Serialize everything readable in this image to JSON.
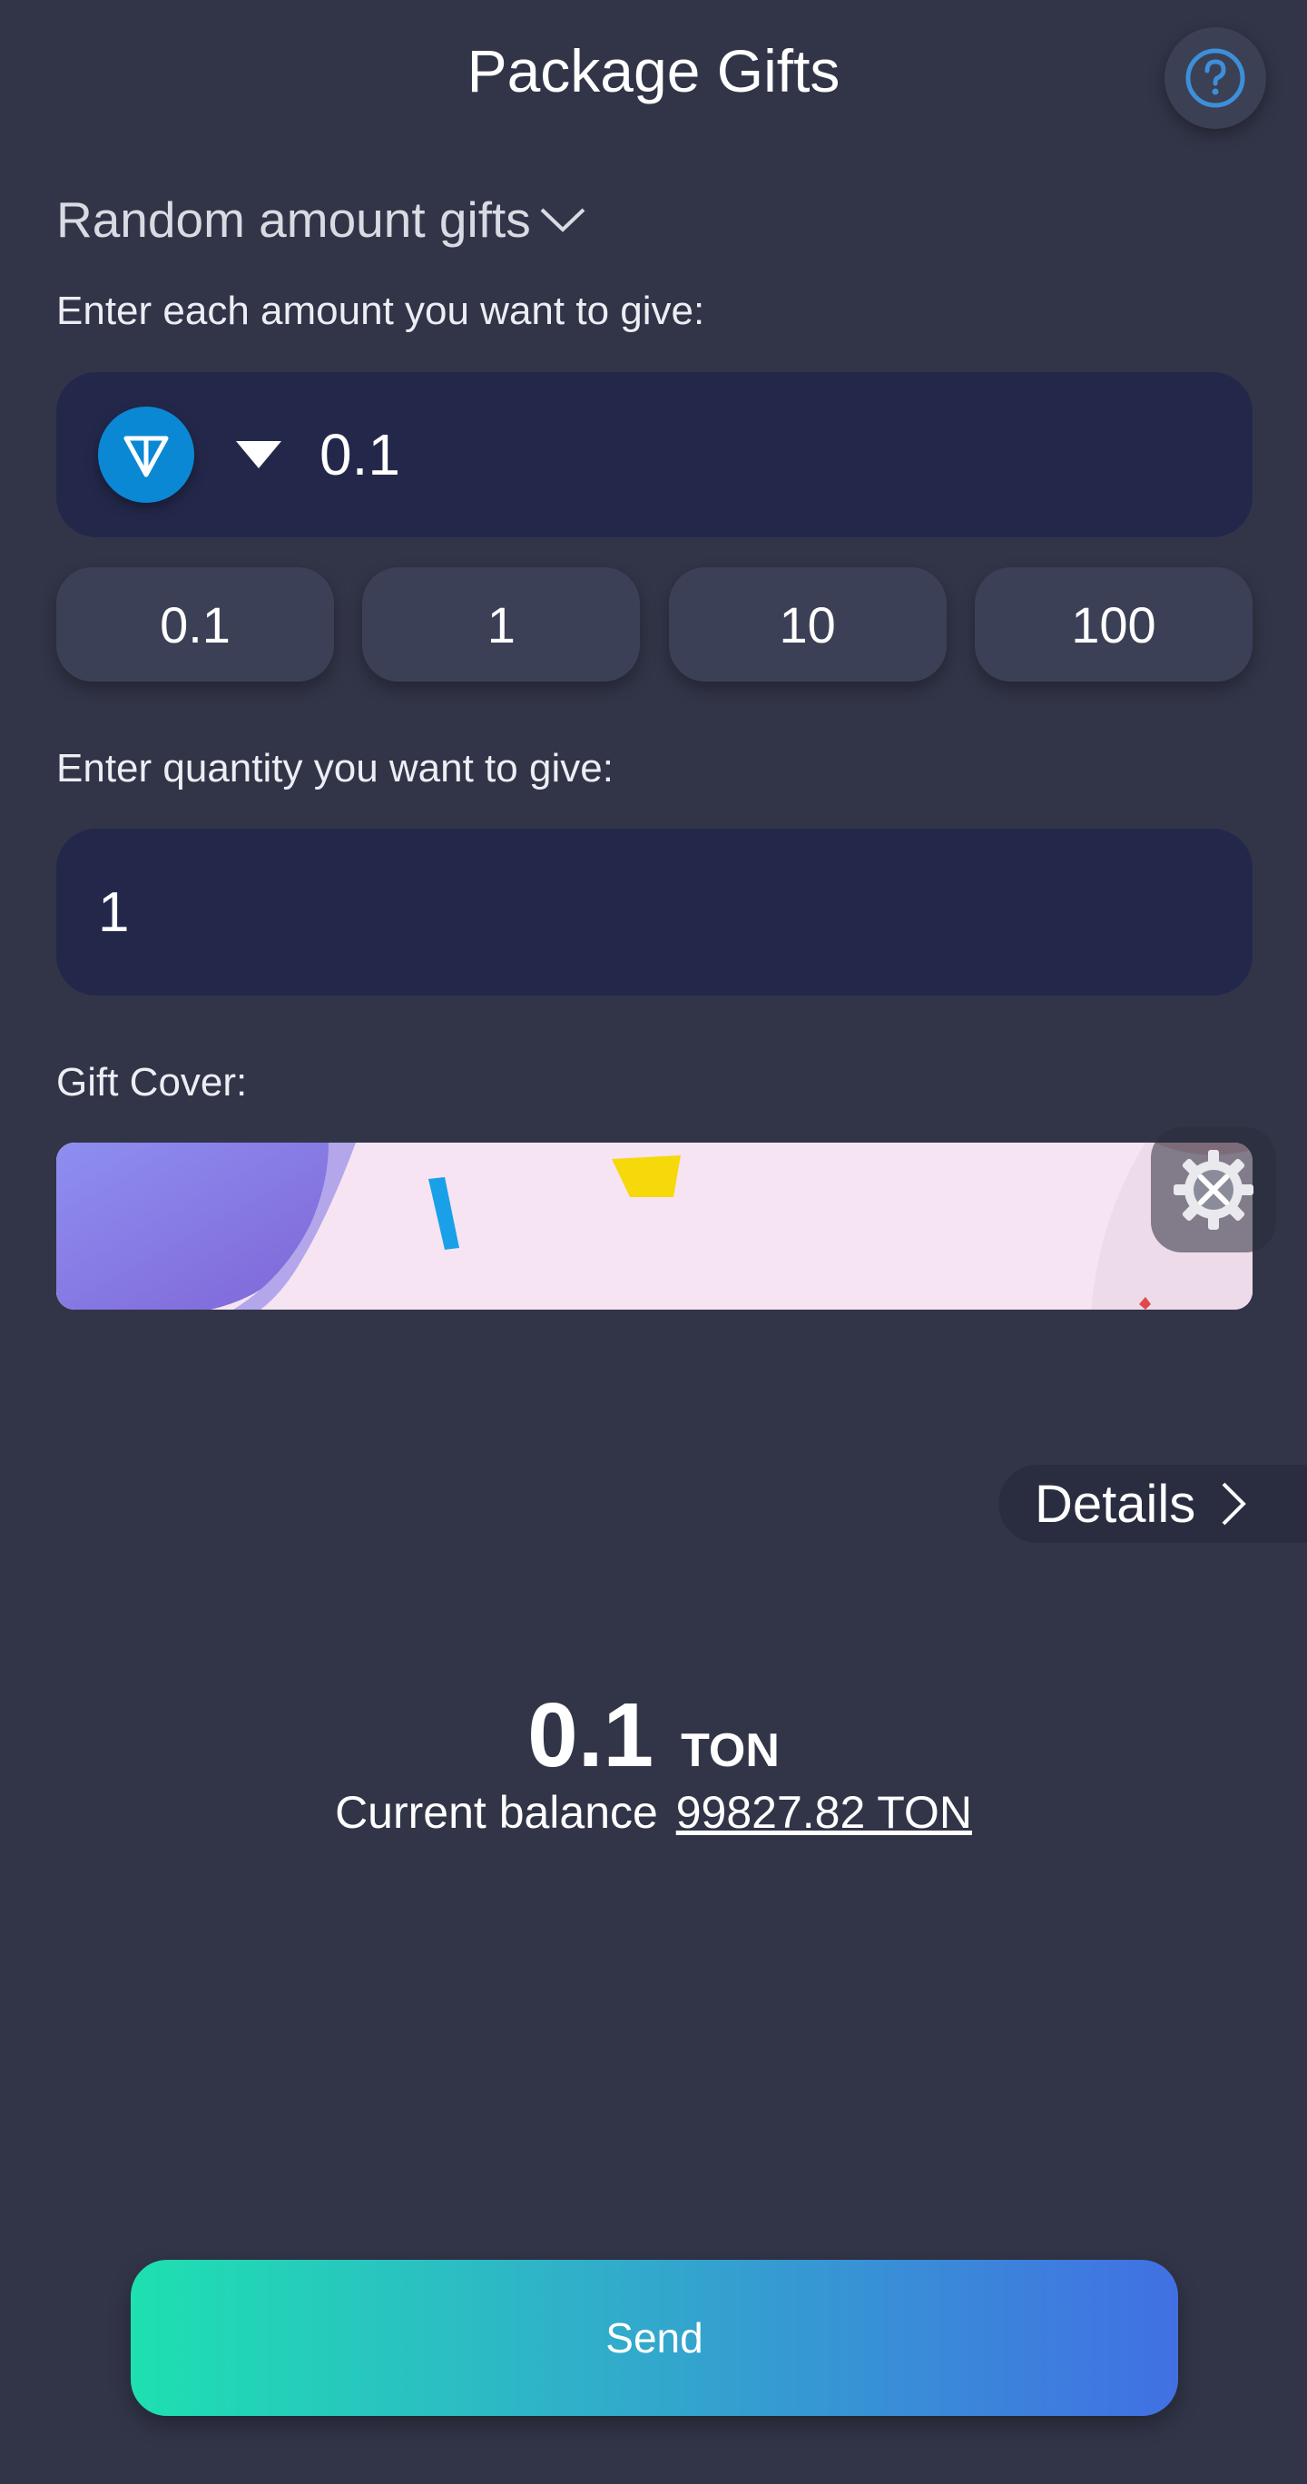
{
  "header": {
    "title": "Package Gifts",
    "help_icon": "question-circle-icon"
  },
  "gift_mode": {
    "label": "Random amount gifts",
    "chevron_icon": "chevron-down-icon"
  },
  "amount": {
    "label": "Enter each amount you want to give:",
    "token_icon": "ton-coin-icon",
    "value": "0.1",
    "presets": [
      "0.1",
      "1",
      "10",
      "100"
    ]
  },
  "quantity": {
    "label": "Enter quantity you want to give:",
    "value": "1"
  },
  "cover": {
    "label": "Gift Cover:"
  },
  "settings_icon": "settings-tools-icon",
  "details": {
    "label": "Details"
  },
  "summary": {
    "total_value": "0.1",
    "total_unit": "TON",
    "balance_label": "Current balance",
    "balance_value": "99827.82 TON"
  },
  "send": {
    "label": "Send"
  },
  "colors": {
    "background": "#323548",
    "field": "#23284b",
    "preset": "#3c4056",
    "ton_blue": "#0b88d4",
    "send_gradient_start": "#1ee0b0",
    "send_gradient_end": "#4170e3"
  }
}
